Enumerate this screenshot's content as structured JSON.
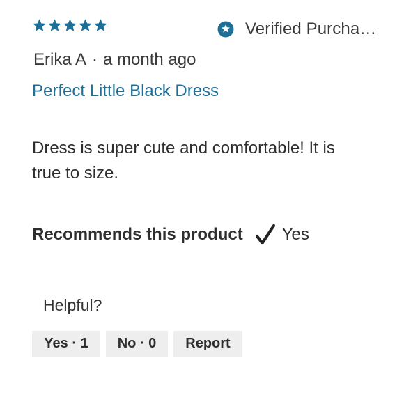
{
  "review": {
    "rating": 5,
    "rating_max": 5,
    "star_color": "#1f6f97",
    "star_icon": "star-icon",
    "verified": {
      "icon": "star-badge-icon",
      "label": "Verified Purcha…"
    },
    "author": "Erika A",
    "separator": "·",
    "time_ago": "a month ago",
    "title": "Perfect Little Black Dress",
    "title_color": "#1f6f97",
    "body": "Dress is super cute and comfortable! It is true to size.",
    "recommends": {
      "label": "Recommends this product",
      "icon": "checkmark-icon",
      "value": "Yes"
    },
    "helpful": {
      "prompt": "Helpful?",
      "yes_label": "Yes · 1",
      "no_label": "No · 0",
      "report_label": "Report"
    }
  }
}
